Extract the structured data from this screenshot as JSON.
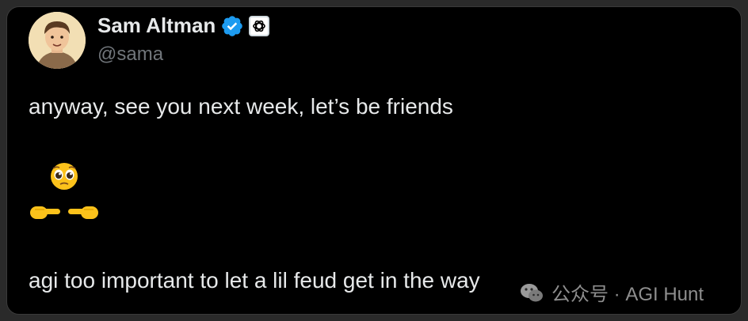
{
  "author": {
    "display_name": "Sam Altman",
    "handle": "@sama",
    "avatar_icon": "cartoon-avatar",
    "verified_icon": "verified-badge-icon",
    "affiliation_icon": "openai-logo-icon"
  },
  "tweet": {
    "line1": "anyway, see you next week, let’s be friends",
    "emoji_icon": "pleading-face-and-pointing-fingers-emoji",
    "line2": "agi too important to let a lil feud get in the way"
  },
  "watermark": {
    "text": "公众号 · AGI Hunt",
    "icon": "wechat-icon"
  },
  "colors": {
    "background": "#000000",
    "text": "#e7e9ea",
    "secondary_text": "#71767b",
    "verified_blue": "#1d9bf0"
  }
}
